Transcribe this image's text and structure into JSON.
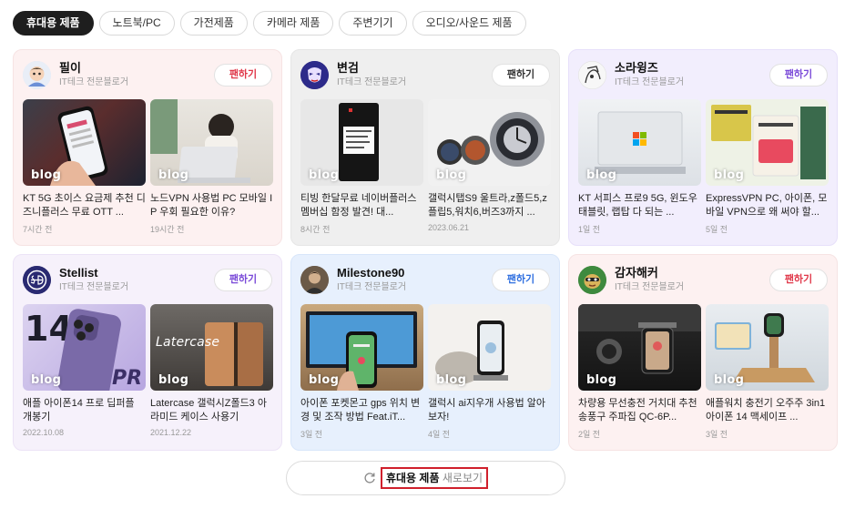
{
  "tabs": [
    {
      "label": "휴대용 제품",
      "active": true
    },
    {
      "label": "노트북/PC",
      "active": false
    },
    {
      "label": "가전제품",
      "active": false
    },
    {
      "label": "카메라 제품",
      "active": false
    },
    {
      "label": "주변기기",
      "active": false
    },
    {
      "label": "오디오/사운드 제품",
      "active": false
    }
  ],
  "fan_label": "팬하기",
  "thumb_badge": "blog",
  "cards": [
    {
      "name": "필이",
      "subtitle": "IT테크 전문블로거",
      "theme": "pink",
      "fan_color": "#e0384a",
      "avatar_icon": "character-avatar",
      "posts": [
        {
          "title": "KT 5G 초이스 요금제 추천 디즈니플러스 무료 OTT ...",
          "date": "7시간 전",
          "thumb": "phone-in-hand"
        },
        {
          "title": "노드VPN 사용법 PC 모바일 IP 우회 필요한 이유?",
          "date": "19시간 전",
          "thumb": "woman-laptop"
        }
      ]
    },
    {
      "name": "변검",
      "subtitle": "IT테크 전문블로거",
      "theme": "gray",
      "fan_color": "#333333",
      "avatar_icon": "mask-avatar",
      "posts": [
        {
          "title": "티빙 한달무료 네이버플러스 멤버십 함정 발견! 대...",
          "date": "8시간 전",
          "thumb": "black-card"
        },
        {
          "title": "갤럭시탭S9 울트라,z폴드5,z플립5,워치6,버즈3까지 ...",
          "date": "2023.06.21",
          "thumb": "smartwatches"
        }
      ]
    },
    {
      "name": "소라윙즈",
      "subtitle": "IT테크 전문블로거",
      "theme": "violet",
      "fan_color": "#7a4ad8",
      "avatar_icon": "drawing-avatar",
      "posts": [
        {
          "title": "KT 서피스 프로9 5G, 윈도우 태블릿, 랩탑 다 되는 ...",
          "date": "1일 전",
          "thumb": "surface-tablet"
        },
        {
          "title": "ExpressVPN PC, 아이폰, 모바일 VPN으로 왜 써야 할...",
          "date": "5일 전",
          "thumb": "vpn-books"
        }
      ]
    },
    {
      "name": "Stellist",
      "subtitle": "IT테크 전문블로거",
      "theme": "pink",
      "fan_color": "#7a4ad8",
      "avatar_icon": "sd-logo-avatar",
      "posts": [
        {
          "title": "애플 아이폰14 프로 딥퍼플 개봉기",
          "date": "2022.10.08",
          "thumb": "purple-iphone"
        },
        {
          "title": "Latercase 갤럭시Z폴드3 아라미드 케이스 사용기",
          "date": "2021.12.22",
          "thumb": "fold-case",
          "overlay": "Latercase"
        }
      ]
    },
    {
      "name": "Milestone90",
      "subtitle": "IT테크 전문블로거",
      "theme": "blue",
      "fan_color": "#2f6fe0",
      "avatar_icon": "portrait-avatar",
      "posts": [
        {
          "title": "아이폰 포켓몬고 gps 위치 변경 및 조작 방법 Feat.iT...",
          "date": "3일 전",
          "thumb": "iphone-map"
        },
        {
          "title": "갤럭시 ai지우개 사용법 알아보자!",
          "date": "4일 전",
          "thumb": "phone-stand"
        }
      ]
    },
    {
      "name": "감자해커",
      "subtitle": "IT테크 전문블로거",
      "theme": "pink",
      "fan_color": "#e0384a",
      "avatar_icon": "potato-avatar",
      "posts": [
        {
          "title": "차량용 무선충전 거치대 추천 송풍구 주파집 QC-6P...",
          "date": "2일 전",
          "thumb": "car-mount"
        },
        {
          "title": "애플워치 충전기 오주주 3in1 아이폰 14 맥세이프 ...",
          "date": "3일 전",
          "thumb": "charger-stand"
        }
      ]
    }
  ],
  "more_button": {
    "bold": "휴대용 제품",
    "rest": "새로보기"
  }
}
